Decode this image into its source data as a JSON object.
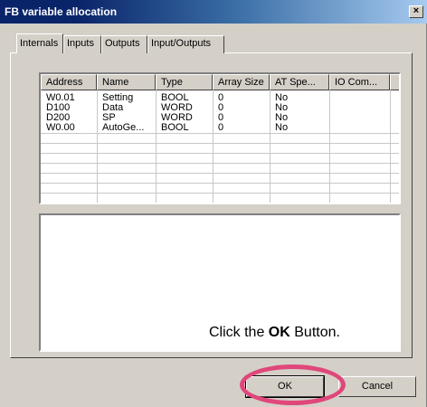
{
  "window": {
    "title": "FB variable allocation",
    "close_glyph": "×"
  },
  "tabs": [
    {
      "label": "Internals",
      "active": true
    },
    {
      "label": "Inputs",
      "active": false
    },
    {
      "label": "Outputs",
      "active": false
    },
    {
      "label": "Input/Outputs",
      "active": false
    }
  ],
  "table": {
    "headers": [
      "Address",
      "Name",
      "Type",
      "Array Size",
      "AT Spe...",
      "IO Com..."
    ],
    "rows": [
      [
        "W0.01",
        "Setting",
        "BOOL",
        "0",
        "No",
        ""
      ],
      [
        "D100",
        "Data",
        "WORD",
        "0",
        "No",
        ""
      ],
      [
        "D200",
        "SP",
        "WORD",
        "0",
        "No",
        ""
      ],
      [
        "W0.00",
        "AutoGe...",
        "BOOL",
        "0",
        "No",
        ""
      ]
    ]
  },
  "instruction": {
    "prefix": "Click the ",
    "bold": "OK",
    "suffix": " Button."
  },
  "buttons": {
    "ok_label": "OK",
    "cancel_label": "Cancel"
  },
  "colors": {
    "highlight": "#e0477b",
    "title_bar": "#0a246a"
  }
}
